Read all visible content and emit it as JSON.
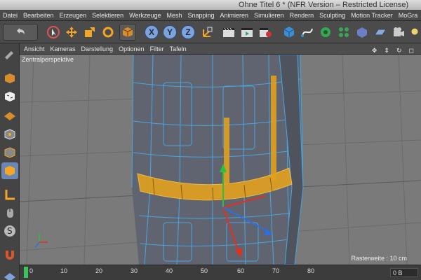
{
  "window": {
    "title": "Ohne Titel 6 * (NFR Version – Restricted License)"
  },
  "menu": [
    "Datei",
    "Bearbeiten",
    "Erzeugen",
    "Selektieren",
    "Werkzeuge",
    "Mesh",
    "Snapping",
    "Animieren",
    "Simulieren",
    "Rendern",
    "Sculpting",
    "Motion Tracker",
    "MoGra"
  ],
  "toolbar": {
    "axis_x": "X",
    "axis_y": "Y",
    "axis_z": "Z"
  },
  "viewport_menu": [
    "Ansicht",
    "Kameras",
    "Darstellung",
    "Optionen",
    "Filter",
    "Tafeln"
  ],
  "viewport": {
    "label": "Zentralperspektive",
    "grid_spacing": "Rasterweite : 10 cm"
  },
  "timeline": {
    "ticks": [
      "0",
      "10",
      "20",
      "30",
      "40",
      "50",
      "60",
      "70",
      "80"
    ],
    "current_frame": "0 B"
  },
  "colors": {
    "accent": "#6b86b5",
    "wire": "#4aa6e0",
    "selection": "#f0a800"
  }
}
